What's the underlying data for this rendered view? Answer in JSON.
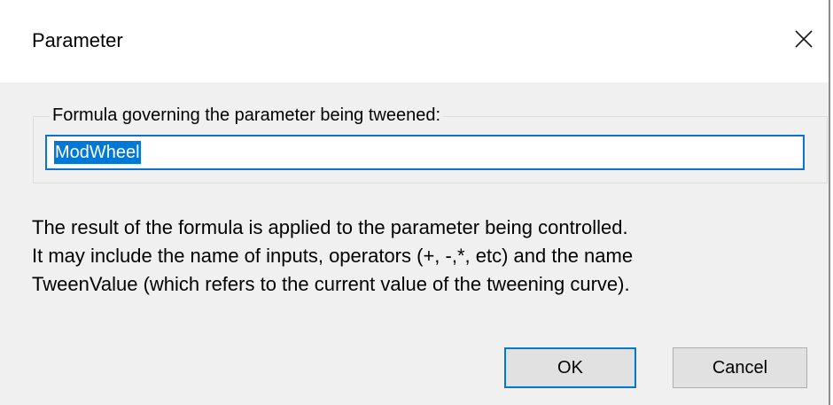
{
  "window": {
    "title": "Parameter"
  },
  "group": {
    "label": "Formula governing the parameter being tweened:",
    "input_value": "ModWheel"
  },
  "help": {
    "lines": [
      "The result of the formula is applied to the parameter being controlled.",
      "It may include the name of inputs, operators (+, -,*, etc) and the name",
      "TweenValue (which refers to the current value of the tweening curve)."
    ]
  },
  "buttons": {
    "ok_label": "OK",
    "cancel_label": "Cancel"
  },
  "icons": {
    "close": "close-icon"
  },
  "colors": {
    "accent": "#0078d7",
    "dialog_bg": "#f0f0f0",
    "titlebar_bg": "#ffffff",
    "button_bg": "#e1e1e1"
  }
}
